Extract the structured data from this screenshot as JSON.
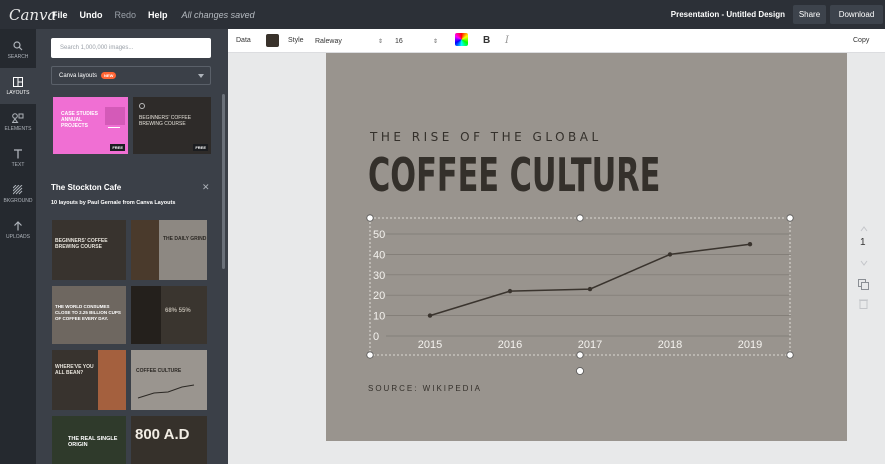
{
  "app": {
    "logo": "Canva",
    "menu": [
      "File",
      "Undo",
      "Redo",
      "Help"
    ],
    "save_status": "All changes saved",
    "doc_title": "Presentation - Untitled Design",
    "share_label": "Share",
    "download_label": "Download"
  },
  "rail": [
    {
      "label": "SEARCH",
      "icon": "search-icon"
    },
    {
      "label": "LAYOUTS",
      "icon": "layouts-icon"
    },
    {
      "label": "ELEMENTS",
      "icon": "elements-icon"
    },
    {
      "label": "TEXT",
      "icon": "text-icon"
    },
    {
      "label": "BKGROUND",
      "icon": "background-icon"
    },
    {
      "label": "UPLOADS",
      "icon": "uploads-icon"
    }
  ],
  "panel": {
    "search_placeholder": "Search 1,000,000 images...",
    "dropdown_label": "Canva layouts",
    "dropdown_badge": "NEW",
    "featured": [
      {
        "text": "CASE STUDIES ANNUAL PROJECTS",
        "badge": "FREE"
      },
      {
        "text": "BEGINNERS' COFFEE BREWING COURSE",
        "badge": "FREE"
      }
    ],
    "section_title": "The Stockton Cafe",
    "section_subtitle": "10 layouts by Paul Gernale from Canva Layouts",
    "layouts": [
      "BEGINNERS' COFFEE BREWING COURSE",
      "THE DAILY GRIND",
      "THE WORLD CONSUMES CLOSE TO 2.25 BILLION CUPS OF COFFEE EVERY DAY.",
      "68% 55%",
      "WHERE'VE YOU ALL BEAN?",
      "COFFEE CULTURE",
      "THE REAL SINGLE ORIGIN",
      "800 A.D"
    ]
  },
  "toolbar": {
    "data_label": "Data",
    "style_label": "Style",
    "font": "Raleway",
    "size": "16",
    "bold": "B",
    "italic": "I",
    "copy_label": "Copy",
    "text_color": "#39322b"
  },
  "slide": {
    "heading_small": "THE RISE OF THE GLOBAL",
    "heading_large": "COFFEE CULTURE",
    "source": "SOURCE: WIKIPEDIA",
    "page_number": "1"
  },
  "chart_data": {
    "type": "line",
    "x": [
      "2015",
      "2016",
      "2017",
      "2018",
      "2019"
    ],
    "y": [
      10,
      22,
      23,
      40,
      45
    ],
    "yticks": [
      0,
      10,
      20,
      30,
      40,
      50
    ],
    "ylim": [
      0,
      50
    ],
    "grid": true,
    "line_color": "#3a342e"
  }
}
